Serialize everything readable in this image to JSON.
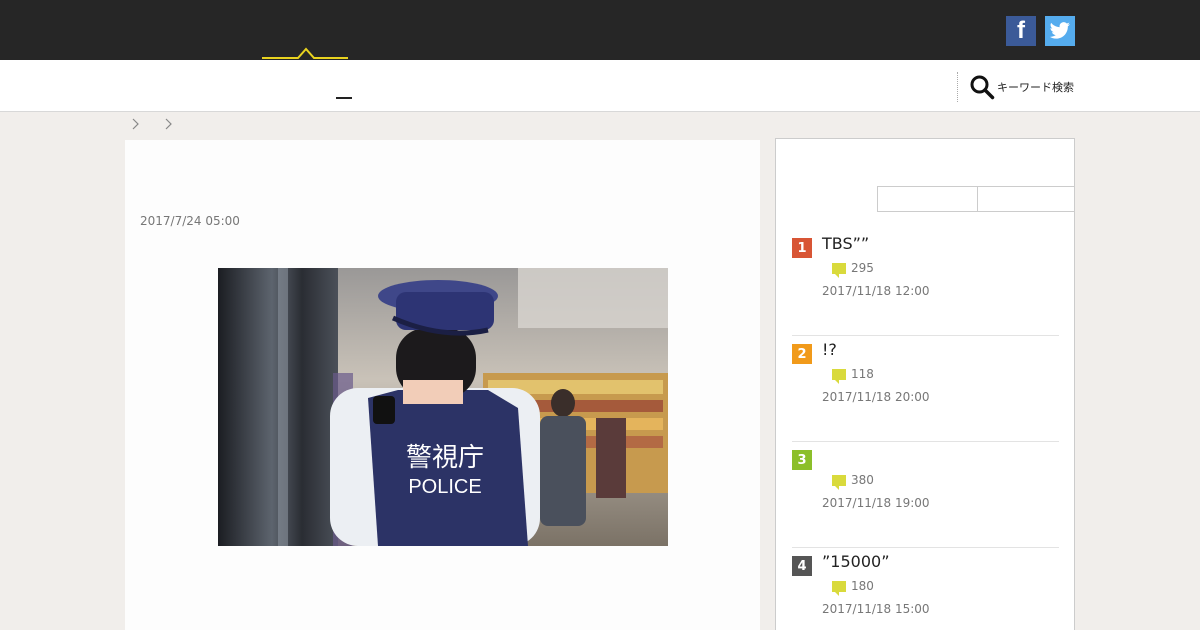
{
  "header": {
    "social": [
      {
        "name": "facebook-icon",
        "glyph": "f"
      },
      {
        "name": "twitter-icon",
        "glyph": "twitter-bird"
      }
    ]
  },
  "nav": {
    "search_label": "キーワード検索"
  },
  "article": {
    "date": "2017/7/24 05:00",
    "photo": {
      "badge_kanji": "警視庁",
      "badge_text": "POLICE"
    }
  },
  "ranking": {
    "items": [
      {
        "rank": "1",
        "title": "TBS””",
        "comments": "295",
        "time": "2017/11/18 12:00",
        "color": "#d85535"
      },
      {
        "rank": "2",
        "title": "!?",
        "comments": "118",
        "time": "2017/11/18 20:00",
        "color": "#f19a1a"
      },
      {
        "rank": "3",
        "title": "",
        "comments": "380",
        "time": "2017/11/18 19:00",
        "color": "#8cbf2a"
      },
      {
        "rank": "4",
        "title": "”15000”",
        "comments": "180",
        "time": "2017/11/18 15:00",
        "color": "#555555"
      }
    ]
  }
}
